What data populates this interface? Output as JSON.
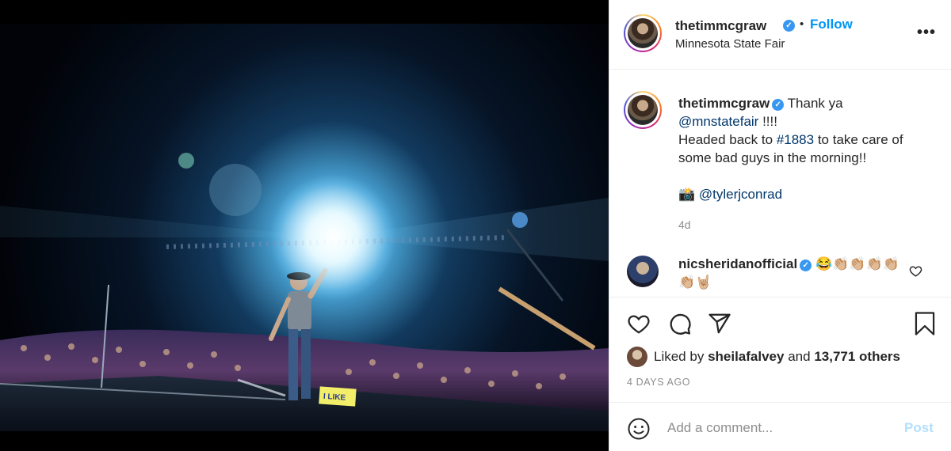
{
  "header": {
    "username": "thetimmcgraw",
    "separator": "•",
    "follow_label": "Follow",
    "location": "Minnesota State Fair",
    "more_label": "•••"
  },
  "caption": {
    "username": "thetimmcgraw",
    "text_1": "Thank ya",
    "mention": "@mnstatefair",
    "text_2": " !!!!",
    "text_3": "Headed back to ",
    "hashtag": "#1883",
    "text_4": " to take care of some bad guys in the morning!!",
    "camera_emoji": "📸",
    "credit": "@tylerjconrad",
    "age": "4d"
  },
  "reply": {
    "username": "nicsheridanofficial",
    "emojis": "😂👏🏼👏🏼👏🏼👏🏼👏🏼🤘🏼"
  },
  "likes": {
    "prefix": "Liked by ",
    "user": "sheilafalvey",
    "middle": " and ",
    "count": "13,771 others"
  },
  "posted_date": "4 DAYS AGO",
  "comment_box": {
    "placeholder": "Add a comment...",
    "post_label": "Post"
  },
  "photo": {
    "sign_text": "I LIKE"
  },
  "colors": {
    "link": "#00376b",
    "follow": "#0095f6",
    "verified": "#3897f0",
    "post_disabled": "#b2dffc",
    "muted": "#8e8e8e"
  }
}
